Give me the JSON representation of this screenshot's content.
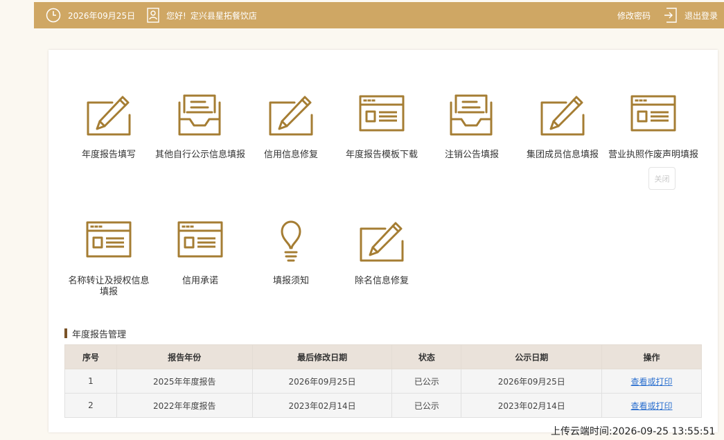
{
  "header": {
    "date": "2026年09月25日",
    "greeting": "您好!",
    "company": "定兴县星拓餐饮店",
    "change_password": "修改密码",
    "logout": "退出登录"
  },
  "tiles": [
    {
      "label": "年度报告填写",
      "icon": "pencil-icon"
    },
    {
      "label": "其他自行公示信息填报",
      "icon": "inbox-icon"
    },
    {
      "label": "信用信息修复",
      "icon": "pencil-icon"
    },
    {
      "label": "年度报告模板下载",
      "icon": "window-icon"
    },
    {
      "label": "注销公告填报",
      "icon": "inbox-icon"
    },
    {
      "label": "集团成员信息填报",
      "icon": "pencil-icon"
    },
    {
      "label": "营业执照作废声明填报",
      "icon": "window-icon"
    },
    {
      "label": "名称转让及授权信息填报",
      "icon": "window-icon"
    },
    {
      "label": "信用承诺",
      "icon": "window-icon"
    },
    {
      "label": "填报须知",
      "icon": "lightbulb-icon"
    },
    {
      "label": "除名信息修复",
      "icon": "pencil-icon"
    }
  ],
  "close_label": "关闭",
  "section": {
    "title": "年度报告管理"
  },
  "table": {
    "headers": [
      "序号",
      "报告年份",
      "最后修改日期",
      "状态",
      "公示日期",
      "操作"
    ],
    "rows": [
      [
        "1",
        "2025年年度报告",
        "2026年09月25日",
        "已公示",
        "2026年09月25日",
        "查看或打印"
      ],
      [
        "2",
        "2022年年度报告",
        "2023年02月14日",
        "已公示",
        "2023年02月14日",
        "查看或打印"
      ]
    ]
  },
  "upload_time": "上传云端时间:2026-09-25 13:55:51",
  "colors": {
    "accent": "#cfa764",
    "icon": "#a57d33",
    "link": "#2a6fcf"
  }
}
